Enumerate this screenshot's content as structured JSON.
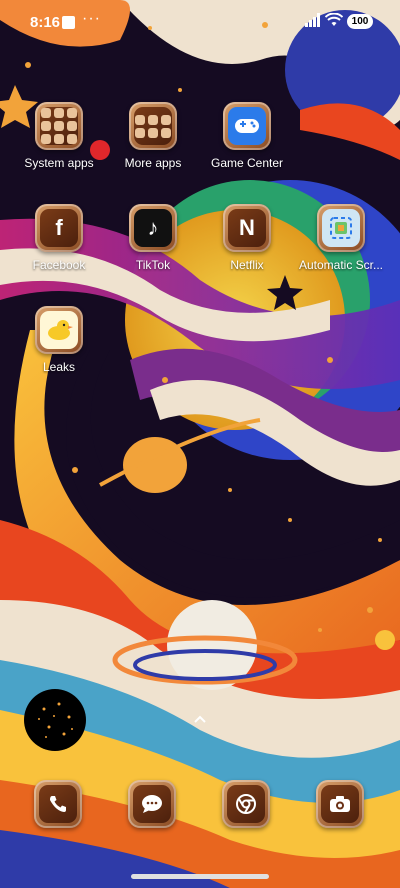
{
  "status_bar": {
    "time": "8:16",
    "overflow_indicator": "···",
    "battery": "100"
  },
  "apps": [
    {
      "label": "System apps",
      "icon": "folder-icon"
    },
    {
      "label": "More apps",
      "icon": "folder-icon"
    },
    {
      "label": "Game Center",
      "icon": "gamepad-icon"
    },
    {
      "label": "Facebook",
      "icon": "facebook-icon",
      "glyph": "f"
    },
    {
      "label": "TikTok",
      "icon": "tiktok-icon",
      "glyph": "♪"
    },
    {
      "label": "Netflix",
      "icon": "netflix-icon",
      "glyph": "N"
    },
    {
      "label": "Automatic Scr...",
      "icon": "scroller-icon"
    },
    {
      "label": "Leaks",
      "icon": "duck-icon"
    }
  ],
  "dock": [
    {
      "icon": "phone-icon",
      "glyph": "✆"
    },
    {
      "icon": "messages-icon",
      "glyph": "···"
    },
    {
      "icon": "chrome-icon",
      "glyph": "◎"
    },
    {
      "icon": "camera-icon",
      "glyph": "◉"
    }
  ],
  "colors": {
    "icon_frame": "#d9a06b",
    "icon_fill": "#6a3015",
    "game_center_blue": "#2b7bea"
  }
}
